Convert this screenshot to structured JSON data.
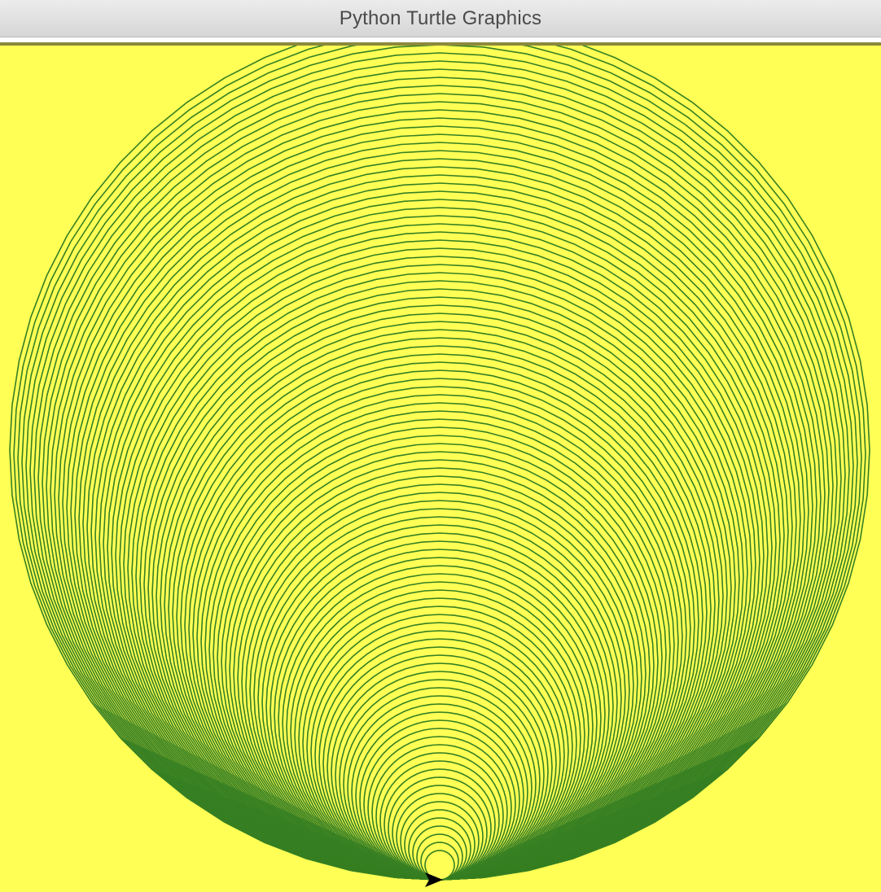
{
  "window": {
    "title": "Python Turtle Graphics"
  },
  "canvas": {
    "background_color": "#ffff55",
    "pen_color": "#367f22",
    "turtle_color": "#000000",
    "turtle_shape": "classic-arrow",
    "drawing": "nested circles sharing a common bottom tangent point"
  }
}
